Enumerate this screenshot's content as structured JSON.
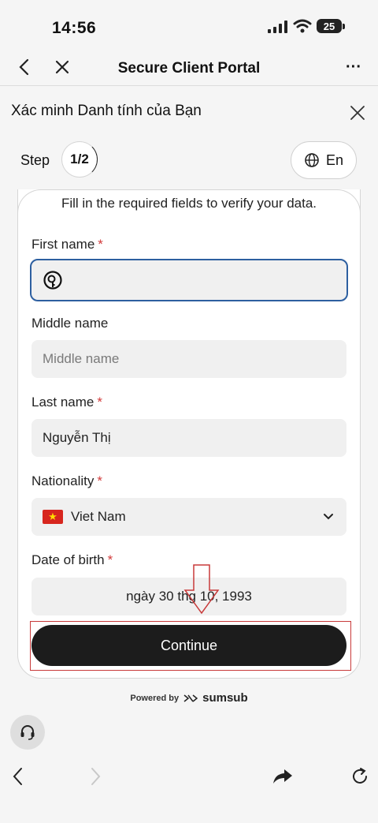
{
  "status_bar": {
    "time": "14:56",
    "battery": "25"
  },
  "browser": {
    "title": "Secure Client Portal",
    "more_label": "···"
  },
  "page": {
    "heading": "Xác minh Danh tính của Bạn",
    "step_label": "Step",
    "step_value": "1/2",
    "language": "En",
    "instruction": "Fill in the required fields to verify your data."
  },
  "form": {
    "first_name": {
      "label": "First name",
      "required_mark": "*",
      "value": ""
    },
    "middle_name": {
      "label": "Middle name",
      "placeholder": "Middle name",
      "value": ""
    },
    "last_name": {
      "label": "Last name",
      "required_mark": "*",
      "value": "Nguyễn Thị"
    },
    "nationality": {
      "label": "Nationality",
      "required_mark": "*",
      "value": "Viet Nam"
    },
    "date_of_birth": {
      "label": "Date of birth",
      "required_mark": "*",
      "value": "ngày 30 thg 10, 1993"
    },
    "continue_label": "Continue"
  },
  "footer": {
    "powered_by": "Powered by",
    "brand": "sumsub"
  },
  "colors": {
    "primary_button": "#1c1c1c",
    "focus_border": "#2d5fa0",
    "required": "#d23b3b",
    "annotation": "#c83a3a"
  }
}
